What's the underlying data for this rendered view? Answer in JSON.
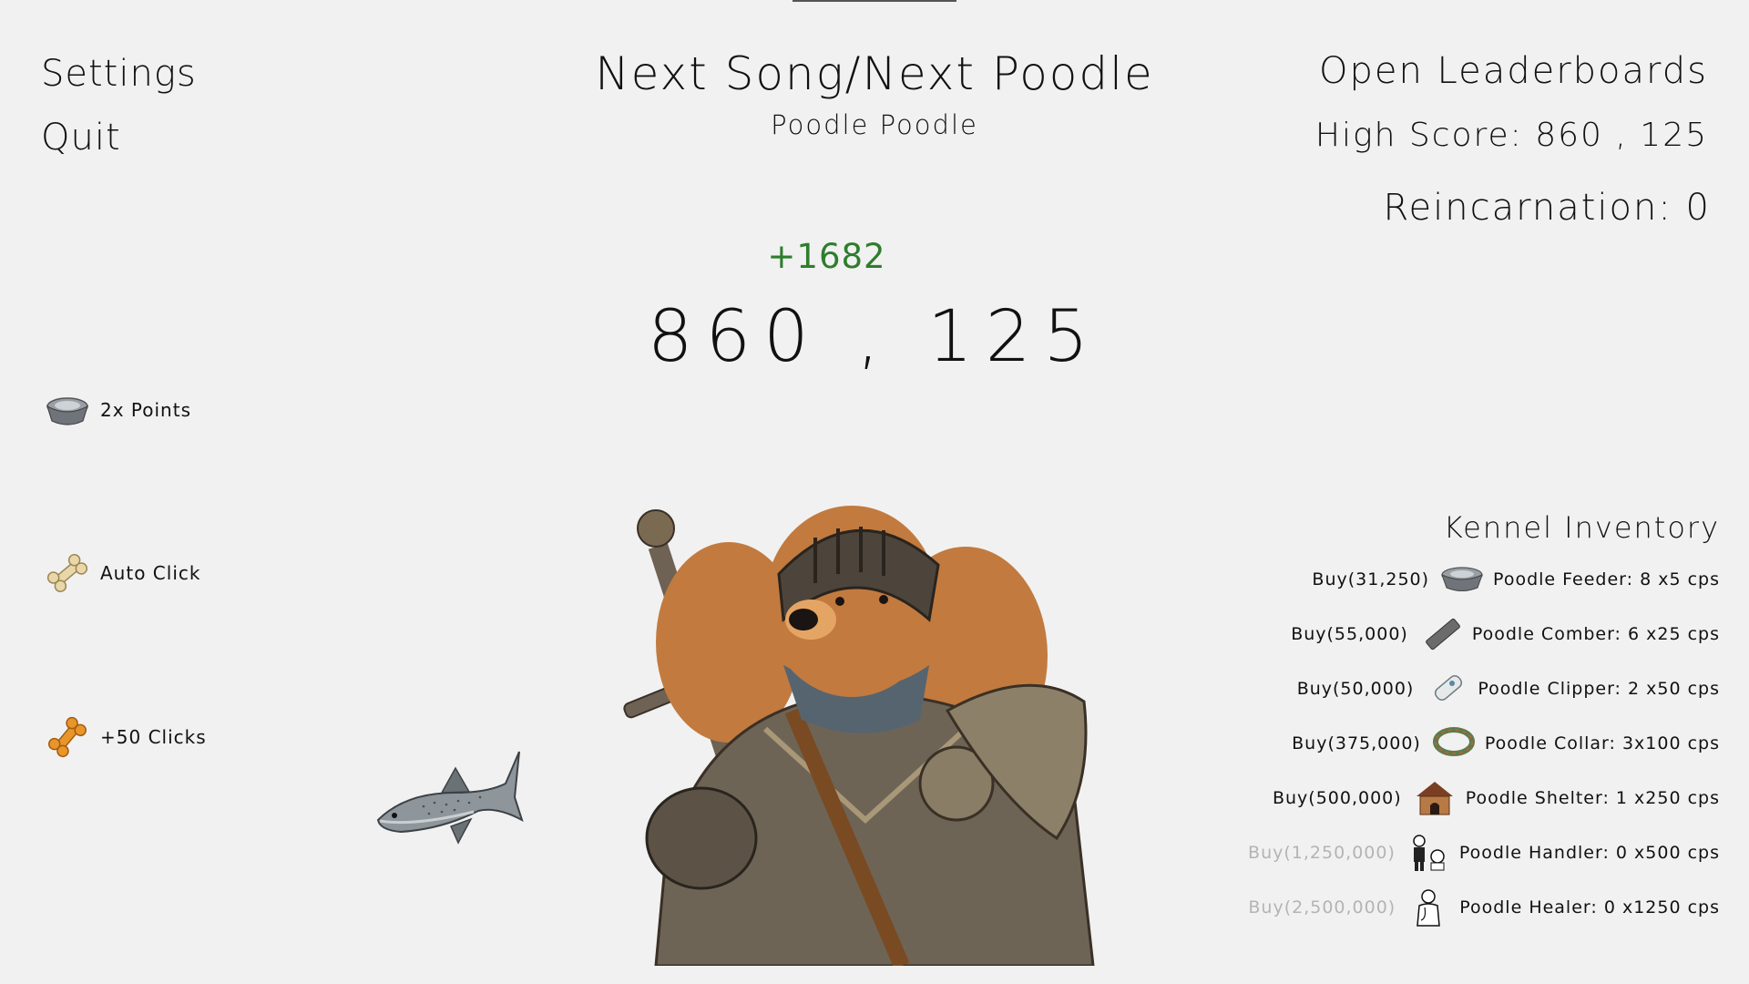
{
  "menu": {
    "settings": "Settings",
    "quit": "Quit"
  },
  "header": {
    "song_button": "Next Song/Next Poodle",
    "song_name": "Poodle Poodle"
  },
  "leaderboards": "Open Leaderboards",
  "high_score": "High Score: 860 , 125",
  "reincarnation": "Reincarnation: 0",
  "score": {
    "gain": "+1682",
    "value": "860 , 125"
  },
  "powerups": [
    {
      "label": "2x Points",
      "icon": "bowl-icon"
    },
    {
      "label": "Auto Click",
      "icon": "bone-icon"
    },
    {
      "label": "+50 Clicks",
      "icon": "orange-bone-icon"
    }
  ],
  "inventory": {
    "title": "Kennel Inventory",
    "items": [
      {
        "buy": "Buy(31,250)",
        "label": "Poodle Feeder: 8 x5 cps",
        "icon": "feeder-bowl-icon",
        "affordable": true
      },
      {
        "buy": "Buy(55,000)",
        "label": "Poodle Comber: 6 x25 cps",
        "icon": "comb-icon",
        "affordable": true
      },
      {
        "buy": "Buy(50,000)",
        "label": "Poodle Clipper: 2 x50 cps",
        "icon": "clipper-icon",
        "affordable": true
      },
      {
        "buy": "Buy(375,000)",
        "label": "Poodle Collar: 3x100 cps",
        "icon": "collar-icon",
        "affordable": true
      },
      {
        "buy": "Buy(500,000)",
        "label": "Poodle Shelter: 1 x250 cps",
        "icon": "doghouse-icon",
        "affordable": true
      },
      {
        "buy": "Buy(1,250,000)",
        "label": "Poodle Handler: 0 x500 cps",
        "icon": "handler-icon",
        "affordable": false
      },
      {
        "buy": "Buy(2,500,000)",
        "label": "Poodle Healer: 0 x1250 cps",
        "icon": "healer-icon",
        "affordable": false
      }
    ]
  },
  "colors": {
    "gain": "#2e7d2e",
    "disabled": "#b4b4b4",
    "background": "#f1f1f1"
  }
}
